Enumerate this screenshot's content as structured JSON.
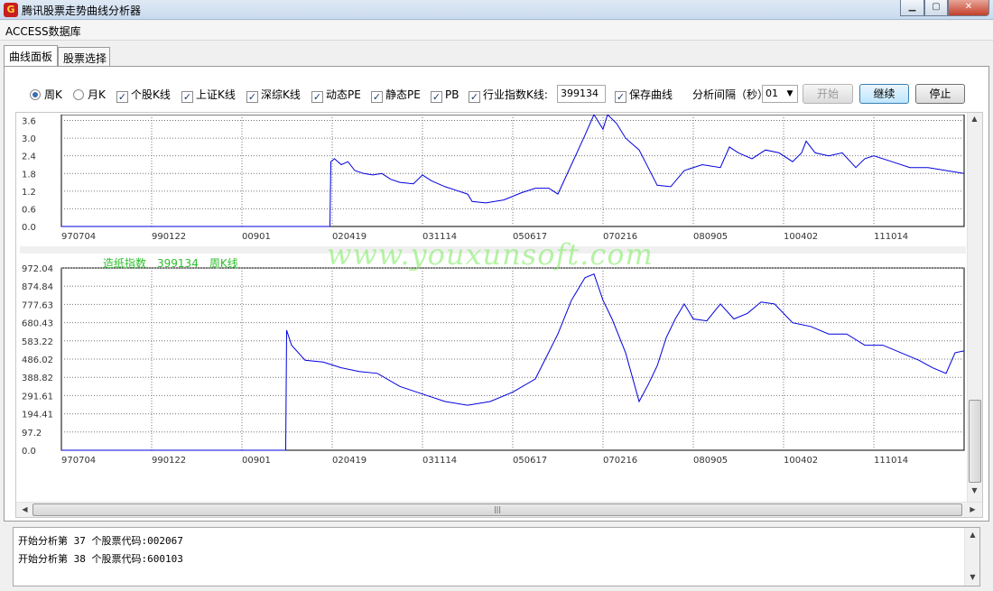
{
  "window": {
    "title": "腾讯股票走势曲线分析器",
    "icon": "app-logo-icon",
    "controls": [
      "minimize",
      "maximize",
      "close"
    ]
  },
  "menu": {
    "database_label": "ACCESS数据库"
  },
  "tabs": [
    {
      "label": "曲线面板",
      "active": true
    },
    {
      "label": "股票选择",
      "active": false
    }
  ],
  "toolbar": {
    "weekly_k": {
      "label": "周K",
      "selected": true
    },
    "monthly_k": {
      "label": "月K",
      "selected": false
    },
    "stock_k": {
      "label": "个股K线",
      "checked": true
    },
    "shanghai_k": {
      "label": "上证K线",
      "checked": true
    },
    "shenzhen_k": {
      "label": "深综K线",
      "checked": true
    },
    "dynamic_pe": {
      "label": "动态PE",
      "checked": true
    },
    "static_pe": {
      "label": "静态PE",
      "checked": true
    },
    "pb": {
      "label": "PB",
      "checked": true
    },
    "industry_k": {
      "label": "行业指数K线:",
      "checked": true
    },
    "industry_code": "399134",
    "save_curve": {
      "label": "保存曲线",
      "checked": true
    },
    "interval_label": "分析间隔（秒）",
    "interval_value": "01",
    "start_label": "开始",
    "continue_label": "继续",
    "stop_label": "停止"
  },
  "watermark": "www.youxunsoft.com",
  "chart_data": [
    {
      "type": "line",
      "title": "",
      "xlabel": "",
      "ylabel": "",
      "x_ticks": [
        "970704",
        "990122",
        "00901",
        "020419",
        "031114",
        "050617",
        "070216",
        "080905",
        "100402",
        "111014"
      ],
      "y_ticks": [
        "0.0",
        "0.6",
        "1.2",
        "1.8",
        "2.4",
        "3.0",
        "3.6"
      ],
      "ylim": [
        0,
        3.8
      ],
      "grid": true,
      "series": [
        {
          "color": "#0000dd",
          "x": [
            0,
            5.95,
            5.97,
            6.05,
            6.2,
            6.35,
            6.5,
            6.7,
            6.9,
            7.1,
            7.3,
            7.5,
            7.8,
            8.0,
            8.2,
            8.5,
            8.8,
            9.0,
            9.1,
            9.4,
            9.8,
            10.2,
            10.5,
            10.8,
            11.0,
            11.3,
            11.6,
            11.8,
            12.0,
            12.1,
            12.3,
            12.5,
            12.8,
            13.0,
            13.2,
            13.5,
            13.8,
            14.2,
            14.6,
            14.8,
            15.0,
            15.3,
            15.6,
            15.9,
            16.2,
            16.4,
            16.5,
            16.7,
            17.0,
            17.3,
            17.6,
            17.8,
            18.0,
            18.4,
            18.8,
            19.2,
            19.6,
            20.0
          ],
          "y": [
            0,
            0,
            2.2,
            2.3,
            2.1,
            2.2,
            1.9,
            1.8,
            1.75,
            1.8,
            1.6,
            1.5,
            1.45,
            1.75,
            1.55,
            1.35,
            1.2,
            1.1,
            0.85,
            0.8,
            0.9,
            1.15,
            1.3,
            1.3,
            1.1,
            2.1,
            3.1,
            4.0,
            3.3,
            3.8,
            3.5,
            3.0,
            2.6,
            2.0,
            1.4,
            1.35,
            1.9,
            2.1,
            2.0,
            2.7,
            2.5,
            2.3,
            2.6,
            2.5,
            2.2,
            2.5,
            2.9,
            2.5,
            2.4,
            2.5,
            2.0,
            2.3,
            2.4,
            2.2,
            2.0,
            2.0,
            1.9,
            1.8
          ]
        }
      ]
    },
    {
      "type": "line",
      "title": "",
      "legend_items": [
        "造纸指数",
        "399134",
        "周K线"
      ],
      "xlabel": "",
      "ylabel": "",
      "x_ticks": [
        "970704",
        "990122",
        "00901",
        "020419",
        "031114",
        "050617",
        "070216",
        "080905",
        "100402",
        "111014"
      ],
      "y_ticks": [
        "0.0",
        "97.2",
        "194.41",
        "291.61",
        "388.82",
        "486.02",
        "583.22",
        "680.43",
        "777.63",
        "874.84",
        "972.04"
      ],
      "ylim": [
        0,
        972.04
      ],
      "grid": true,
      "series": [
        {
          "name": "造纸指数",
          "color": "#0000dd",
          "x": [
            0,
            4.97,
            4.99,
            5.1,
            5.4,
            5.8,
            6.2,
            6.6,
            7.0,
            7.5,
            8.0,
            8.5,
            9.0,
            9.5,
            10.0,
            10.5,
            11.0,
            11.3,
            11.6,
            11.8,
            12.0,
            12.2,
            12.5,
            12.8,
            13.0,
            13.2,
            13.4,
            13.6,
            13.8,
            14.0,
            14.3,
            14.6,
            14.9,
            15.2,
            15.5,
            15.8,
            16.2,
            16.6,
            17.0,
            17.4,
            17.8,
            18.2,
            18.6,
            19.0,
            19.3,
            19.6,
            19.8,
            20.0
          ],
          "y": [
            0,
            0,
            640,
            560,
            480,
            470,
            440,
            420,
            410,
            340,
            300,
            260,
            240,
            260,
            310,
            380,
            620,
            800,
            920,
            940,
            800,
            700,
            520,
            260,
            350,
            450,
            600,
            700,
            780,
            700,
            690,
            780,
            700,
            730,
            790,
            780,
            680,
            660,
            620,
            620,
            560,
            560,
            520,
            480,
            440,
            410,
            520,
            530
          ]
        }
      ]
    }
  ],
  "log": [
    "开始分析第 37 个股票代码:002067",
    "开始分析第 38 个股票代码:600103"
  ]
}
